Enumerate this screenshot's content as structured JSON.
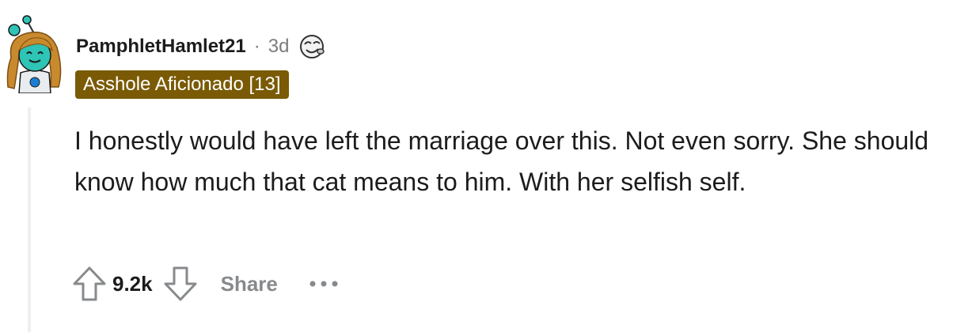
{
  "comment": {
    "author": "PamphletHamlet21",
    "separator": "·",
    "age": "3d",
    "flair": "Asshole Aficionado [13]",
    "text": "I honestly would have left the marriage over this. Not even sorry. She should know how much that cat means to him. With her selfish self."
  },
  "actions": {
    "upvote_icon": "upvote-arrow-icon",
    "score": "9.2k",
    "downvote_icon": "downvote-arrow-icon",
    "share_label": "Share",
    "more_icon": "ellipsis-icon"
  },
  "colors": {
    "flair_background": "#7a5a05",
    "flair_text": "#ffffff",
    "avatar_skin": "#2ec4b6",
    "avatar_hair": "#c98a2e",
    "muted_text": "#7c7c7c",
    "thread_line": "#edeff1"
  }
}
